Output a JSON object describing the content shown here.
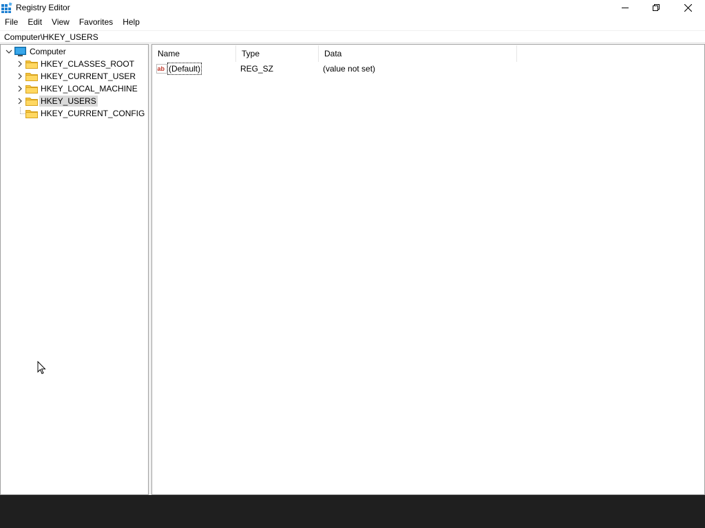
{
  "window": {
    "title": "Registry Editor",
    "controls": {
      "minimize": "minimize",
      "maximize": "restore",
      "close": "close"
    }
  },
  "menu": [
    "File",
    "Edit",
    "View",
    "Favorites",
    "Help"
  ],
  "address": {
    "path": "Computer\\HKEY_USERS"
  },
  "tree": {
    "root": {
      "label": "Computer",
      "icon": "computer-icon",
      "expanded": true
    },
    "items": [
      {
        "label": "HKEY_CLASSES_ROOT",
        "has_children": true,
        "selected": false
      },
      {
        "label": "HKEY_CURRENT_USER",
        "has_children": true,
        "selected": false
      },
      {
        "label": "HKEY_LOCAL_MACHINE",
        "has_children": true,
        "selected": false
      },
      {
        "label": "HKEY_USERS",
        "has_children": true,
        "selected": true
      },
      {
        "label": "HKEY_CURRENT_CONFIG",
        "has_children": false,
        "selected": false
      }
    ]
  },
  "list": {
    "columns": [
      "Name",
      "Type",
      "Data"
    ],
    "rows": [
      {
        "name": "(Default)",
        "type": "REG_SZ",
        "data": "(value not set)",
        "icon": "string-value-icon"
      }
    ]
  },
  "colors": {
    "selection": "#d9d9d9",
    "folder": "#f5c542",
    "computer": "#1f8fd6",
    "taskbar": "#1f1f1f"
  }
}
